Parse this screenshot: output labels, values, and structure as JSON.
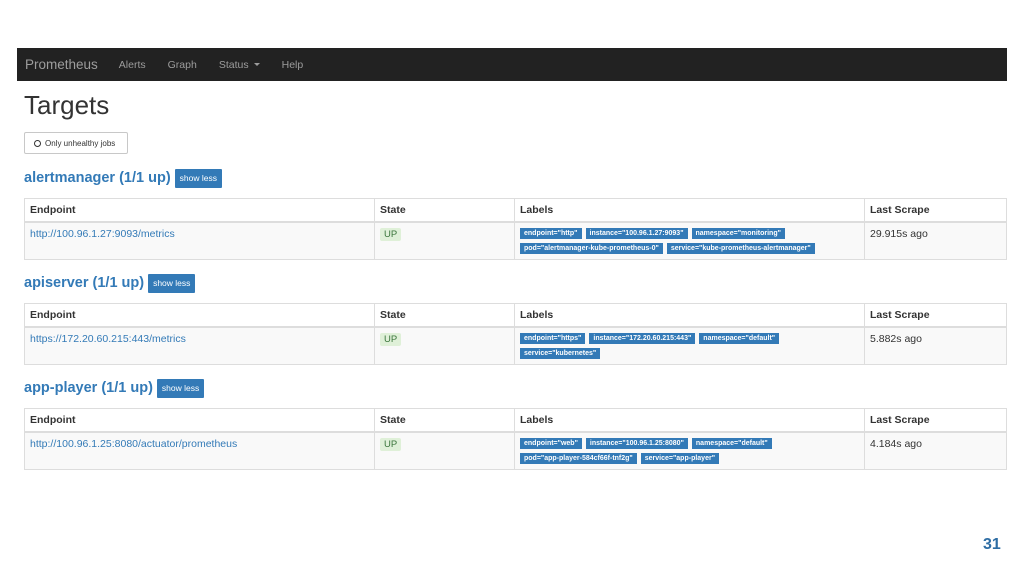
{
  "navbar": {
    "brand": "Prometheus",
    "items": [
      "Alerts",
      "Graph",
      "Status",
      "Help"
    ]
  },
  "page_title": "Targets",
  "filter_label": "Only unhealthy jobs",
  "table_headers": [
    "Endpoint",
    "State",
    "Labels",
    "Last Scrape"
  ],
  "sections": [
    {
      "job": "alertmanager (1/1 up)",
      "toggle": "show less",
      "endpoint": "http://100.96.1.27:9093/metrics",
      "state": "UP",
      "labels": [
        "endpoint=\"http\"",
        "instance=\"100.96.1.27:9093\"",
        "namespace=\"monitoring\"",
        "pod=\"alertmanager-kube-prometheus-0\"",
        "service=\"kube-prometheus-alertmanager\""
      ],
      "last_scrape": "29.915s ago"
    },
    {
      "job": "apiserver (1/1 up)",
      "toggle": "show less",
      "endpoint": "https://172.20.60.215:443/metrics",
      "state": "UP",
      "labels": [
        "endpoint=\"https\"",
        "instance=\"172.20.60.215:443\"",
        "namespace=\"default\"",
        "service=\"kubernetes\""
      ],
      "last_scrape": "5.882s ago"
    },
    {
      "job": "app-player (1/1 up)",
      "toggle": "show less",
      "endpoint": "http://100.96.1.25:8080/actuator/prometheus",
      "state": "UP",
      "labels": [
        "endpoint=\"web\"",
        "instance=\"100.96.1.25:8080\"",
        "namespace=\"default\"",
        "pod=\"app-player-584cf66f-tnf2g\"",
        "service=\"app-player\""
      ],
      "last_scrape": "4.184s ago"
    }
  ],
  "slide_number": "31",
  "colors": {
    "navbar_bg": "#222222",
    "link": "#337ab7",
    "up_bg": "#dff0d8",
    "up_text": "#3c763d"
  }
}
